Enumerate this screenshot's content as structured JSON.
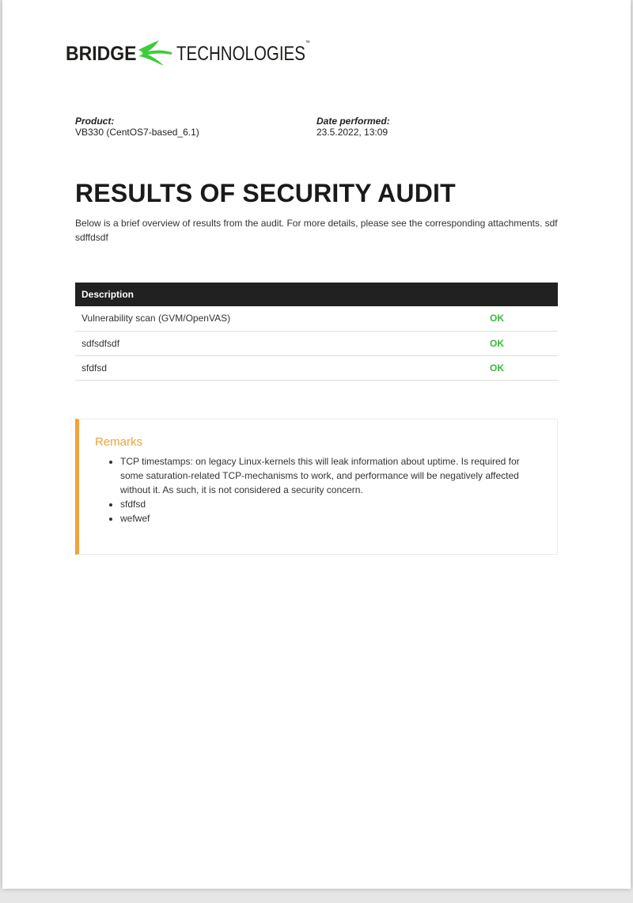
{
  "logo": {
    "word_bold": "BRIDGE",
    "word_light": "TECHNOLOGIES",
    "trademark": "™",
    "brand_color": "#3ccc3c"
  },
  "meta": {
    "product_label": "Product:",
    "product_value": "VB330 (CentOS7-based_6.1)",
    "date_label": "Date performed:",
    "date_value": "23.5.2022, 13:09"
  },
  "title": "RESULTS OF SECURITY AUDIT",
  "intro": "Below is a brief overview of results from the audit. For more details, please see the corresponding attachments. sdf sdffdsdf",
  "results": {
    "header_description": "Description",
    "header_status": "",
    "rows": [
      {
        "description": "Vulnerability scan (GVM/OpenVAS)",
        "status": "OK"
      },
      {
        "description": "sdfsdfsdf",
        "status": "OK"
      },
      {
        "description": "sfdfsd",
        "status": "OK"
      }
    ],
    "ok_color": "#3cb83c"
  },
  "remarks": {
    "heading": "Remarks",
    "accent_color": "#f0a33a",
    "items": [
      "TCP timestamps: on legacy Linux-kernels this will leak information about uptime. Is required for some saturation-related TCP-mechanisms to work, and performance will be negatively affected without it. As such, it is not considered a security concern.",
      "sfdfsd",
      "wefwef"
    ]
  }
}
